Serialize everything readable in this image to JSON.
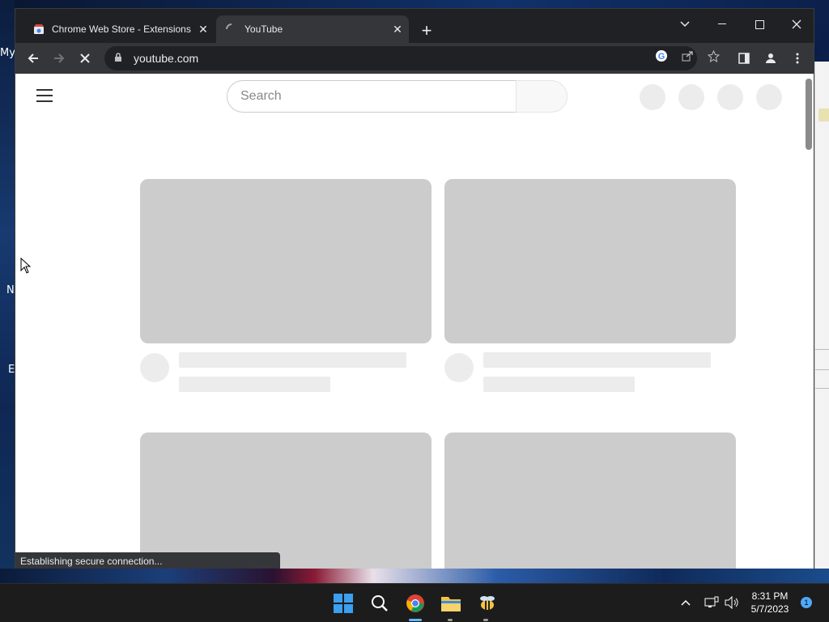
{
  "desktop": {
    "labels": [
      "My",
      "N",
      "E"
    ]
  },
  "tabs": [
    {
      "title": "Chrome Web Store - Extensions",
      "active": false
    },
    {
      "title": "YouTube",
      "active": true
    }
  ],
  "window_controls": {
    "dropdown": "tab-search",
    "minimize": "minimize",
    "maximize": "maximize",
    "close": "close"
  },
  "address_bar": {
    "url": "youtube.com"
  },
  "page": {
    "search_placeholder": "Search"
  },
  "status_bar": {
    "text": "Establishing secure connection..."
  },
  "taskbar": {
    "time": "8:31 PM",
    "date": "5/7/2023",
    "notification_count": "1"
  },
  "colors": {
    "chrome_dark": "#202124",
    "chrome_toolbar": "#35363a",
    "skeleton": "#cccccc",
    "skeleton_light": "#ececec"
  }
}
